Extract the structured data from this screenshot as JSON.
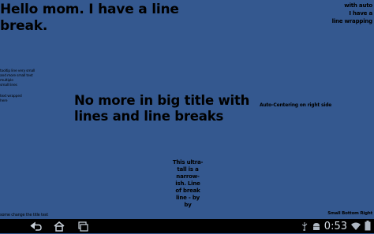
{
  "content": {
    "top_left": "Hello mom. I have a line\nbreak.",
    "top_right": "with auto\nI have a\nline wrapping",
    "left_mid": "tooltip line very small\nand more small text\nmultiple\nsmall lines",
    "left_mid2": "text wrapped\nhere",
    "center": "No more in big title with\nlines and line breaks",
    "right_mid": "Auto-Centering on right side",
    "narrow": "This ultra-\ntall is a\nnarrow-\nish. Line\nof break\nline - by\nby",
    "bottom_left": "some change the title text",
    "bottom_right": "Small Bottom Right"
  },
  "navbar": {
    "back_icon": "back-icon",
    "home_icon": "home-icon",
    "recents_icon": "recent-apps-icon",
    "usb_icon": "usb-icon",
    "android_icon": "android-debug-icon",
    "clock": "0:53",
    "wifi_icon": "wifi-icon",
    "battery_icon": "battery-icon"
  },
  "colors": {
    "background": "#34588f",
    "text": "#000000",
    "navbar": "#000000",
    "status_text": "#d6dde5"
  }
}
